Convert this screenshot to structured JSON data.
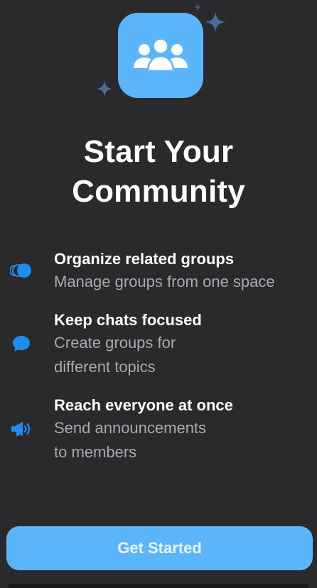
{
  "title": {
    "line1": "Start Your",
    "line2": "Community"
  },
  "hero_icon": "group-icon",
  "features": [
    {
      "icon": "toggle-circles-icon",
      "title": "Organize related groups",
      "subtitle_line1": "Manage groups from one space",
      "subtitle_line2": ""
    },
    {
      "icon": "chat-bubble-icon",
      "title": "Keep chats focused",
      "subtitle_line1": "Create groups for",
      "subtitle_line2": "different topics"
    },
    {
      "icon": "megaphone-icon",
      "title": "Reach everyone at once",
      "subtitle_line1": "Send announcements",
      "subtitle_line2": "to members"
    }
  ],
  "cta": {
    "label": "Get Started"
  },
  "colors": {
    "background": "#2a2a2c",
    "accent": "#5ab5fb",
    "feature_icon": "#1e8cf0",
    "subtitle_text": "#a9a9ae"
  }
}
